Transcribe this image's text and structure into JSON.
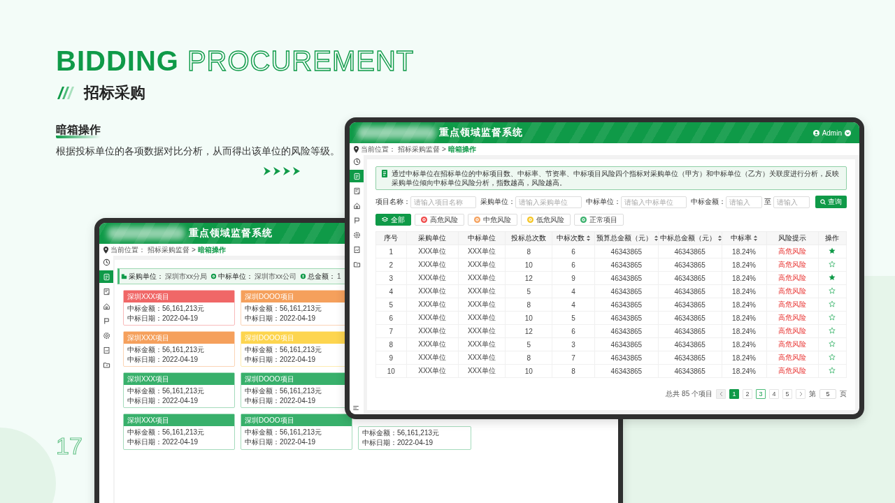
{
  "slide": {
    "title_bold": "BIDDING",
    "title_outline": "PROCUREMENT",
    "subtitle": "招标采购",
    "section": "暗箱操作",
    "description": "根据投标单位的各项数据对比分析，从而得出该单位的风险等级。",
    "page_number": "17"
  },
  "back": {
    "system_title": "重点领域监督系统",
    "breadcrumb": {
      "label": "当前位置：",
      "path": "招标采购监督",
      "separator": ">",
      "current": "暗箱操作"
    },
    "sidebar": [
      {
        "kind": "dashboard",
        "selected": false
      },
      {
        "kind": "document",
        "selected": true
      },
      {
        "kind": "checklist",
        "selected": false
      },
      {
        "kind": "home",
        "selected": false
      },
      {
        "kind": "flag",
        "selected": false
      },
      {
        "kind": "settings",
        "selected": false
      },
      {
        "kind": "report",
        "selected": false
      },
      {
        "kind": "folder",
        "selected": false
      }
    ],
    "summary": [
      {
        "kind": "building",
        "label": "采购单位：",
        "value": "深圳市xx分局"
      },
      {
        "kind": "target",
        "label": "中标单位：",
        "value": "深圳市xx公司"
      },
      {
        "kind": "coin",
        "label": "总金额：",
        "value": "1"
      }
    ],
    "cards": [
      {
        "title": "深圳XXX项目",
        "color": "#f06767",
        "amount_label": "中标金额：",
        "amount": "56,161,213元",
        "date_label": "中标日期：",
        "date": "2022-04-19"
      },
      {
        "title": "深圳DOOO项目",
        "color": "#f5a05c",
        "amount_label": "中标金额：",
        "amount": "56,161,213元",
        "date_label": "中标日期：",
        "date": "2022-04-19"
      },
      {
        "title": "深圳XXX项目",
        "color": "#f5a05c",
        "amount_label": "中标金额：",
        "amount": "56,161,213元",
        "date_label": "中标日期：",
        "date": "2022-04-19"
      },
      {
        "title": "深圳DOOO项目",
        "color": "#fdd54f",
        "amount_label": "中标金额：",
        "amount": "56,161,213元",
        "date_label": "中标日期：",
        "date": "2022-04-19"
      },
      {
        "title": "深圳XXX项目",
        "color": "#38b06b",
        "amount_label": "中标金额：",
        "amount": "56,161,213元",
        "date_label": "中标日期：",
        "date": "2022-04-19"
      },
      {
        "title": "深圳DOOO项目",
        "color": "#38b06b",
        "amount_label": "中标金额：",
        "amount": "56,161,213元",
        "date_label": "中标日期：",
        "date": "2022-04-19"
      },
      {
        "title": "深圳XXX项目",
        "color": "#38b06b",
        "amount_label": "中标金额：",
        "amount": "56,161,213元",
        "date_label": "中标日期：",
        "date": "2022-04-19"
      },
      {
        "title": "深圳DOOO项目",
        "color": "#38b06b",
        "amount_label": "中标金额：",
        "amount": "56,161,213元",
        "date_label": "中标日期：",
        "date": "2022-04-19"
      },
      {
        "amount_label": "中标金额：",
        "amount": "56,161,213元",
        "date_label": "中标日期：",
        "date": "2022-04-19"
      }
    ]
  },
  "front": {
    "system_title": "重点领域监督系统",
    "user": "Admin",
    "breadcrumb": {
      "label": "当前位置：",
      "path": "招标采购监督",
      "separator": ">",
      "current": "暗箱操作"
    },
    "sidebar": [
      {
        "kind": "dashboard",
        "selected": false
      },
      {
        "kind": "document",
        "selected": true
      },
      {
        "kind": "checklist",
        "selected": false
      },
      {
        "kind": "home",
        "selected": false
      },
      {
        "kind": "flag",
        "selected": false
      },
      {
        "kind": "settings",
        "selected": false
      },
      {
        "kind": "report",
        "selected": false
      },
      {
        "kind": "folder",
        "selected": false
      }
    ],
    "notice": "通过中标单位在招标单位的中标项目数、中标率、节资率、中标项目风险四个指标对采购单位（甲方）和中标单位（乙方）关联度进行分析，反映采购单位倾向中标单位风险分析，指数越高，风险越高。",
    "filters": [
      {
        "label": "项目名称：",
        "placeholder": "请输入项目名称"
      },
      {
        "label": "采购单位：",
        "placeholder": "请输入采购单位"
      },
      {
        "label": "中标单位：",
        "placeholder": "请输入中标单位"
      }
    ],
    "amount_filter": {
      "label": "中标金额：",
      "min_placeholder": "请输入",
      "separator": "至",
      "max_placeholder": "请输入"
    },
    "search_button": "查询",
    "tabs": [
      {
        "kind": "all",
        "label": "全部",
        "selected": true
      },
      {
        "kind": "level",
        "label": "高危风险",
        "color": "#f04848",
        "selected": false
      },
      {
        "kind": "level",
        "label": "中危风险",
        "color": "#f5a05c",
        "selected": false
      },
      {
        "kind": "level",
        "label": "低危风险",
        "color": "#f5c524",
        "selected": false
      },
      {
        "kind": "level",
        "label": "正常项目",
        "color": "#38b06b",
        "selected": false
      }
    ],
    "table": {
      "columns": [
        {
          "label": "序号",
          "sortable": false
        },
        {
          "label": "采购单位",
          "sortable": false
        },
        {
          "label": "中标单位",
          "sortable": false
        },
        {
          "label": "投标总次数",
          "sortable": false
        },
        {
          "label": "中标次数",
          "sortable": true
        },
        {
          "label": "预算总金额（元）",
          "sortable": true
        },
        {
          "label": "中标总金额（元）",
          "sortable": true
        },
        {
          "label": "中标率",
          "sortable": true
        },
        {
          "label": "风险提示",
          "sortable": false
        },
        {
          "label": "操作",
          "sortable": false
        }
      ],
      "rows": [
        {
          "cells": [
            "1",
            "XXX单位",
            "XXX单位",
            "8",
            "6",
            "46343865",
            "46343865",
            "18.24%"
          ],
          "risk": "高危风险",
          "favorite": true
        },
        {
          "cells": [
            "2",
            "XXX单位",
            "XXX单位",
            "10",
            "6",
            "46343865",
            "46343865",
            "18.24%"
          ],
          "risk": "高危风险",
          "favorite": false
        },
        {
          "cells": [
            "3",
            "XXX单位",
            "XXX单位",
            "12",
            "9",
            "46343865",
            "46343865",
            "18.24%"
          ],
          "risk": "高危风险",
          "favorite": true
        },
        {
          "cells": [
            "4",
            "XXX单位",
            "XXX单位",
            "5",
            "4",
            "46343865",
            "46343865",
            "18.24%"
          ],
          "risk": "高危风险",
          "favorite": false
        },
        {
          "cells": [
            "5",
            "XXX单位",
            "XXX单位",
            "8",
            "4",
            "46343865",
            "46343865",
            "18.24%"
          ],
          "risk": "高危风险",
          "favorite": false
        },
        {
          "cells": [
            "6",
            "XXX单位",
            "XXX单位",
            "10",
            "5",
            "46343865",
            "46343865",
            "18.24%"
          ],
          "risk": "高危风险",
          "favorite": false
        },
        {
          "cells": [
            "7",
            "XXX单位",
            "XXX单位",
            "12",
            "6",
            "46343865",
            "46343865",
            "18.24%"
          ],
          "risk": "高危风险",
          "favorite": false
        },
        {
          "cells": [
            "8",
            "XXX单位",
            "XXX单位",
            "5",
            "3",
            "46343865",
            "46343865",
            "18.24%"
          ],
          "risk": "高危风险",
          "favorite": false
        },
        {
          "cells": [
            "9",
            "XXX单位",
            "XXX单位",
            "8",
            "7",
            "46343865",
            "46343865",
            "18.24%"
          ],
          "risk": "高危风险",
          "favorite": false
        },
        {
          "cells": [
            "10",
            "XXX单位",
            "XXX单位",
            "10",
            "8",
            "46343865",
            "46343865",
            "18.24%"
          ],
          "risk": "高危风险",
          "favorite": false
        }
      ]
    },
    "pagination": {
      "total": "总共 85 个项目",
      "prev": {
        "disabled": true
      },
      "next": {
        "disabled": false
      },
      "pages": [
        {
          "label": "1",
          "selected": true,
          "hovered": false
        },
        {
          "label": "2",
          "selected": false,
          "hovered": false
        },
        {
          "label": "3",
          "selected": false,
          "hovered": true
        },
        {
          "label": "4",
          "selected": false,
          "hovered": false
        },
        {
          "label": "5",
          "selected": false,
          "hovered": false
        }
      ],
      "goto_prefix": "第",
      "goto_value": "5",
      "goto_suffix": "页"
    }
  }
}
